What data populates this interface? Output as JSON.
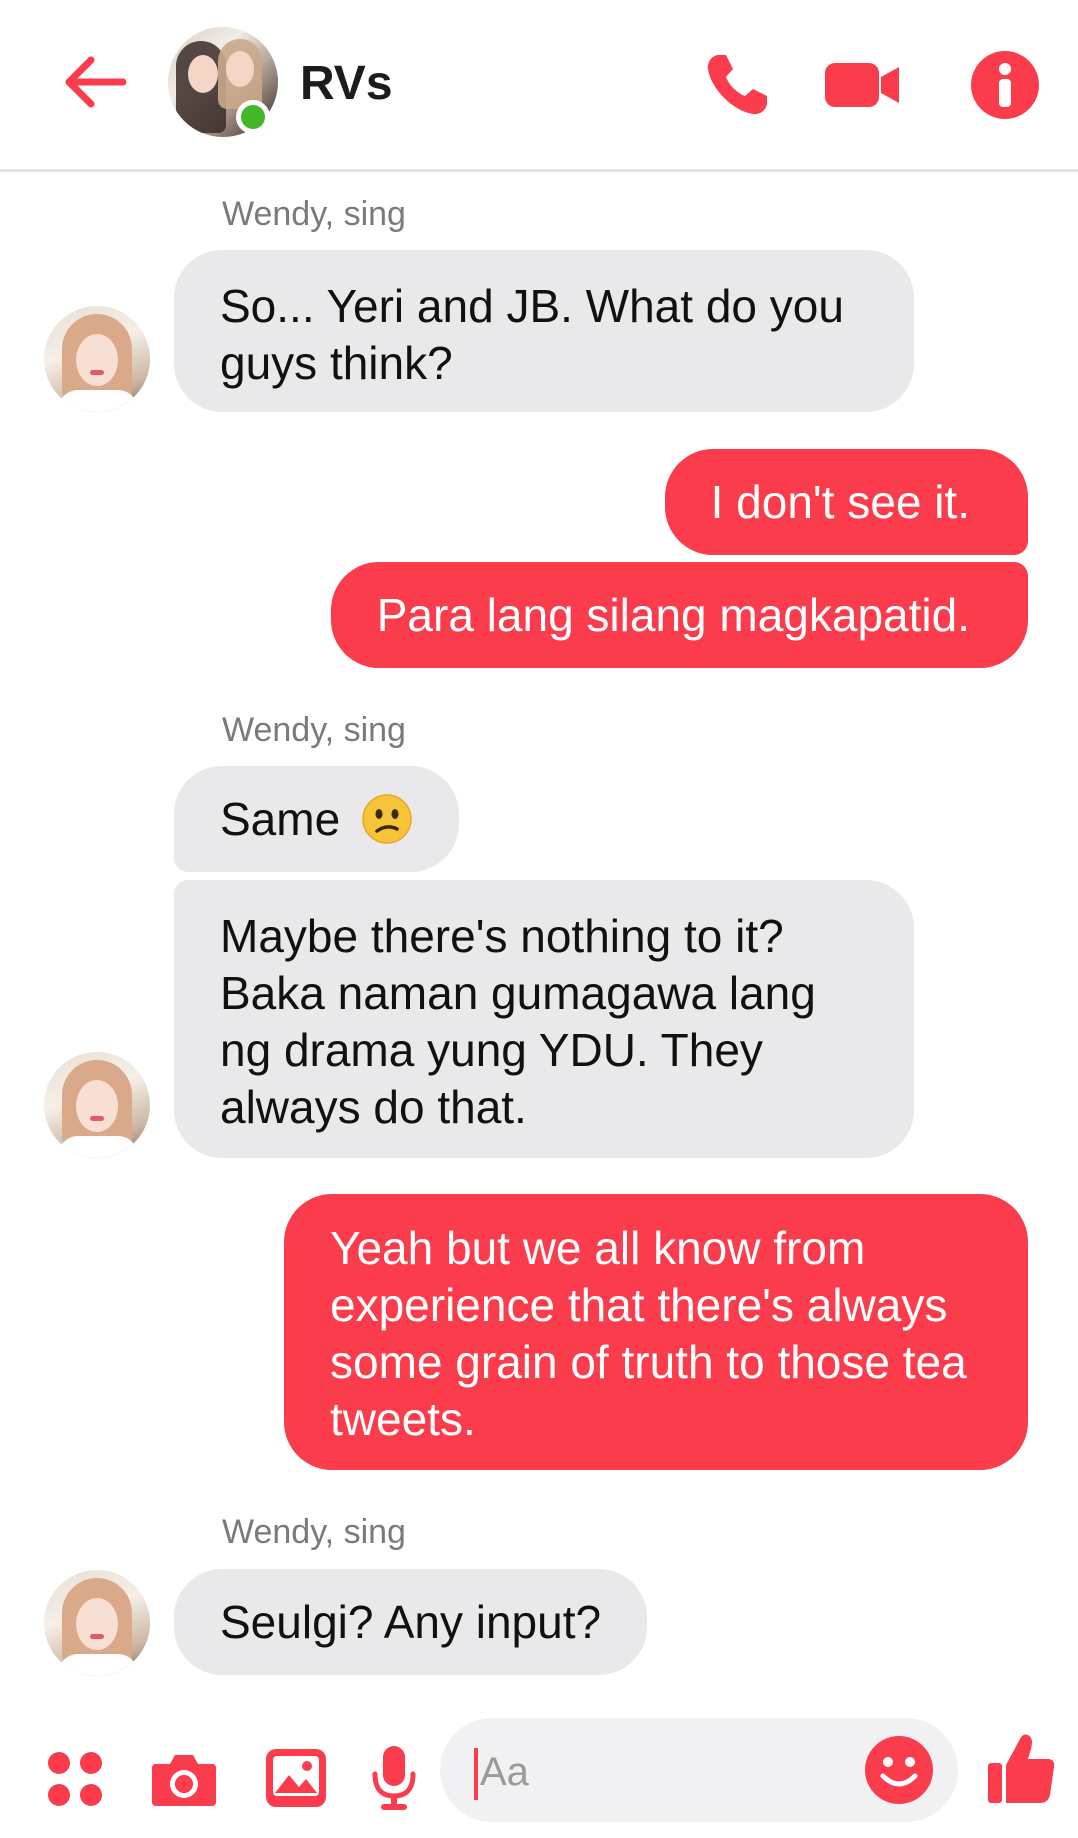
{
  "colors": {
    "accent": "#fa3c4c",
    "online": "#42b72a",
    "incoming_bubble": "#e9e9eb",
    "sender_name": "#7a7a7a"
  },
  "header": {
    "title": "RVs",
    "icons": [
      "back-arrow-icon",
      "phone-icon",
      "video-camera-icon",
      "info-icon"
    ]
  },
  "messages": {
    "group1_sender": "Wendy, sing",
    "msg1": "So... Yeri and JB. What do you guys think?",
    "msg2": "I don't see it.",
    "msg3": "Para lang silang magkapatid.",
    "group2_sender": "Wendy, sing",
    "msg4": "Same",
    "msg4_emoji": "confused-face-emoji",
    "msg5": "Maybe there's nothing to it? Baka naman gumagawa lang ng drama yung YDU. They always do that.",
    "msg6": "Yeah but we all know from experience that there's always some grain of truth to those tea tweets.",
    "group3_sender": "Wendy, sing",
    "msg7": "Seulgi? Any input?"
  },
  "composer": {
    "placeholder": "Aa",
    "icons": [
      "more-apps-icon",
      "camera-icon",
      "gallery-icon",
      "microphone-icon",
      "emoji-icon",
      "thumbs-up-icon"
    ]
  }
}
